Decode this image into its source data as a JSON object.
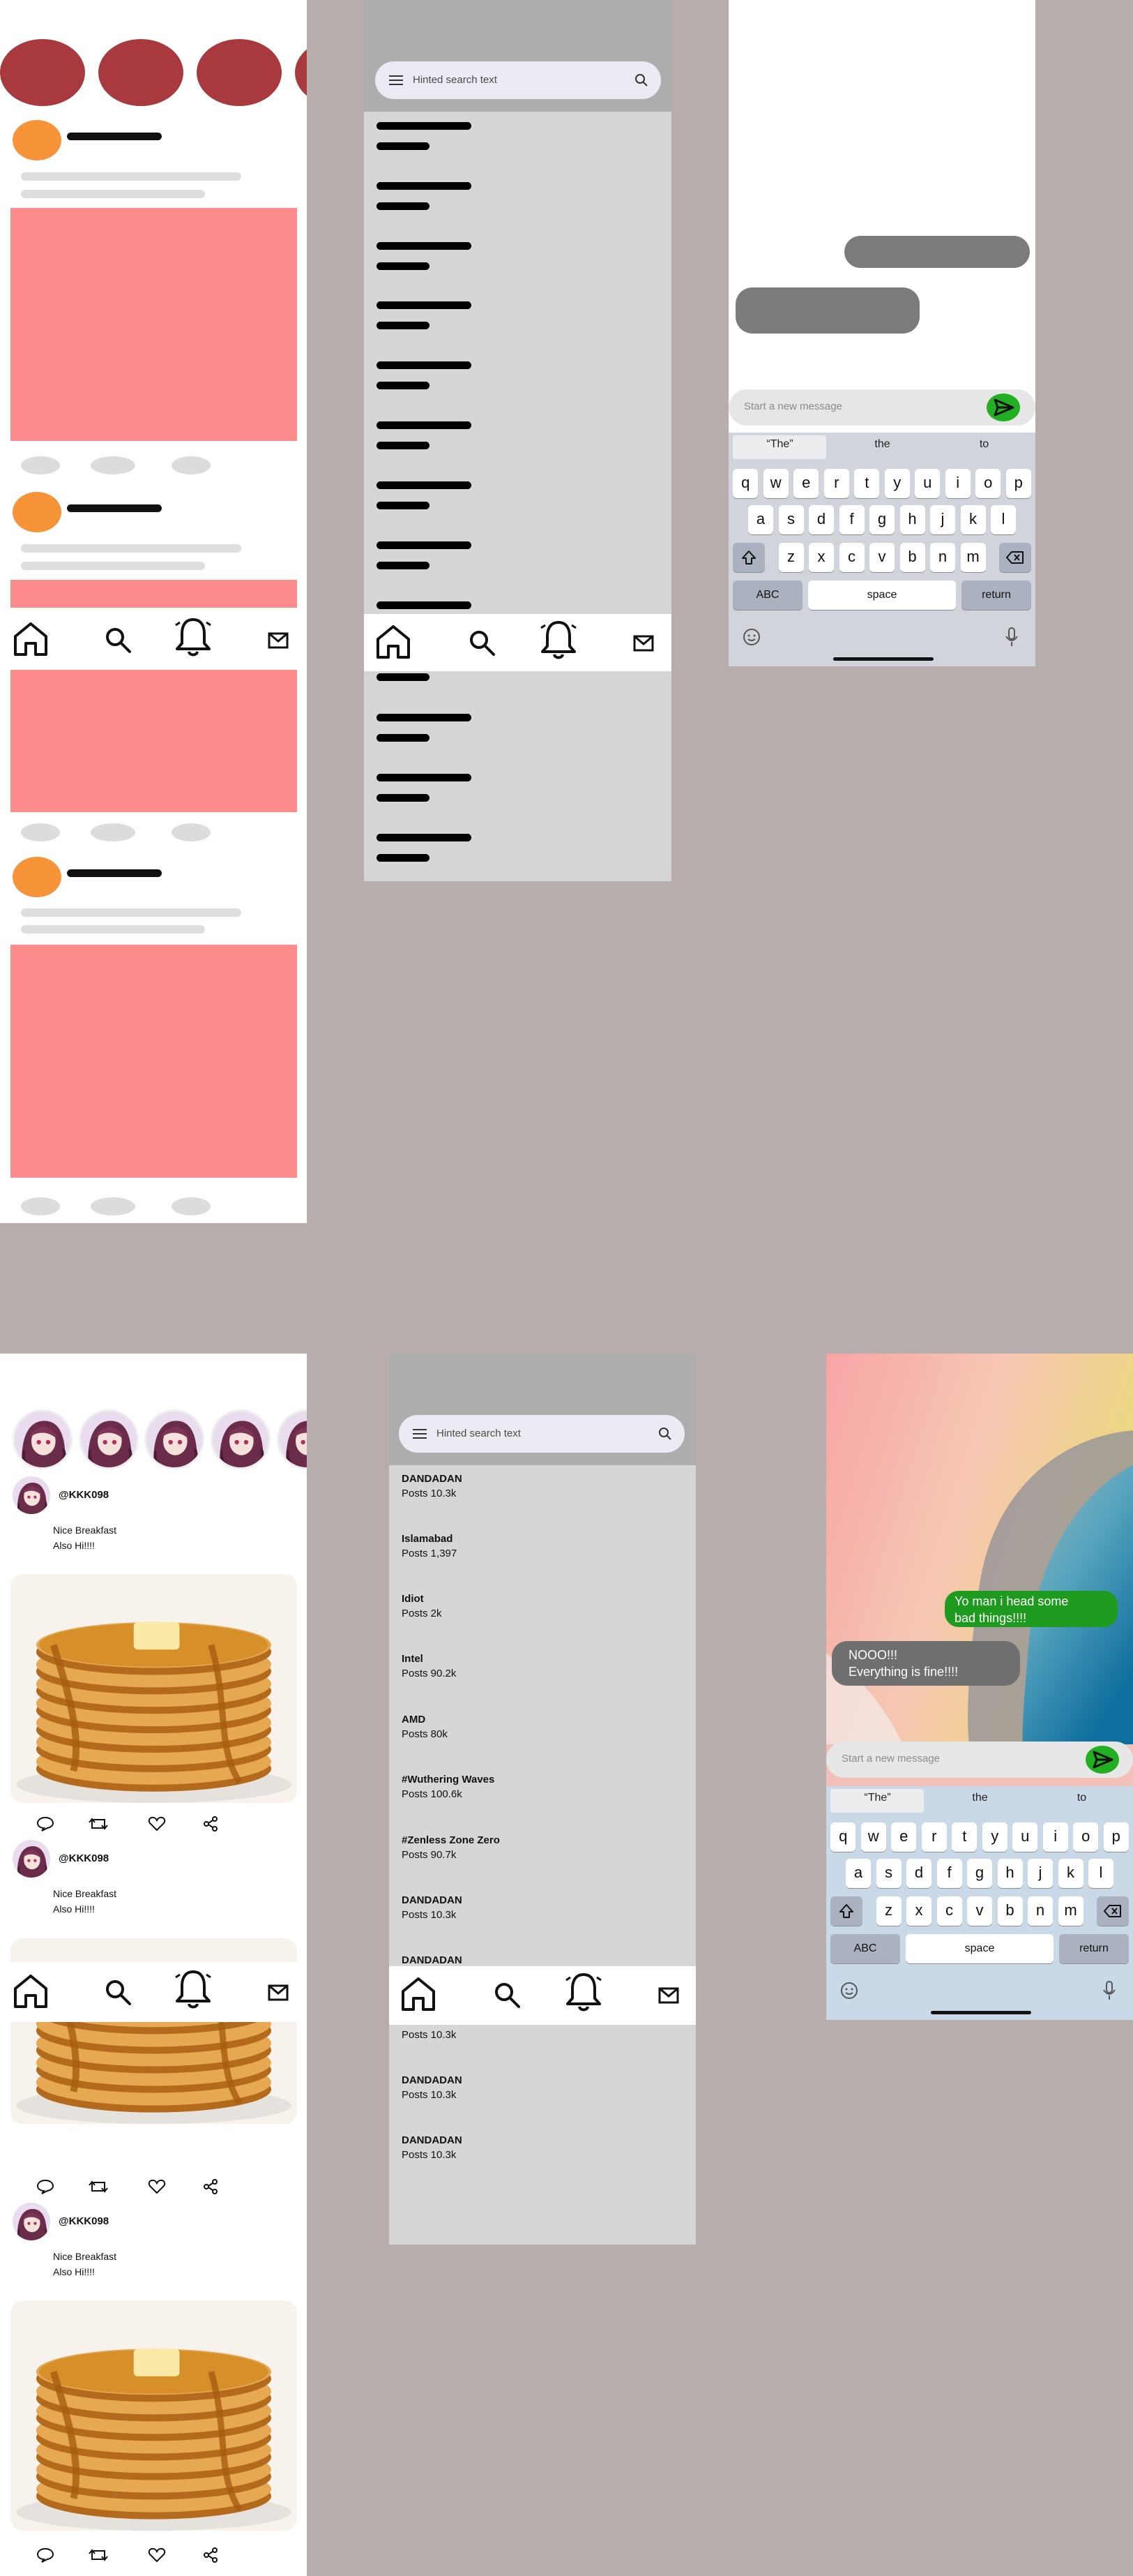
{
  "wireframe": {
    "search": {
      "placeholder": "Hinted search text"
    },
    "chat": {
      "input_placeholder": "Start a new message"
    }
  },
  "keyboard": {
    "suggestions": [
      "“The”",
      "the",
      "to"
    ],
    "row1": [
      "q",
      "w",
      "e",
      "r",
      "t",
      "y",
      "u",
      "i",
      "o",
      "p"
    ],
    "row2": [
      "a",
      "s",
      "d",
      "f",
      "g",
      "h",
      "j",
      "k",
      "l"
    ],
    "row3": [
      "z",
      "x",
      "c",
      "v",
      "b",
      "n",
      "m"
    ],
    "abc_label": "ABC",
    "space_label": "space",
    "return_label": "return"
  },
  "feed": {
    "posts": [
      {
        "handle": "@KKK098",
        "caption_line1": "Nice Breakfast",
        "caption_line2": "Also Hi!!!!"
      },
      {
        "handle": "@KKK098",
        "caption_line1": "Nice Breakfast",
        "caption_line2": "Also Hi!!!!"
      },
      {
        "handle": "@KKK098",
        "caption_line1": "Nice Breakfast",
        "caption_line2": "Also Hi!!!!"
      }
    ]
  },
  "search": {
    "placeholder": "Hinted search text",
    "topics": [
      {
        "title": "DANDADAN",
        "posts": "Posts 10.3k"
      },
      {
        "title": "Islamabad",
        "posts": "Posts 1,397"
      },
      {
        "title": "Idiot",
        "posts": "Posts 2k"
      },
      {
        "title": "Intel",
        "posts": "Posts 90.2k"
      },
      {
        "title": "AMD",
        "posts": "Posts 80k"
      },
      {
        "title": "#Wuthering Waves",
        "posts": "Posts 100.6k"
      },
      {
        "title": "#Zenless Zone Zero",
        "posts": "Posts 90.7k"
      },
      {
        "title": "DANDADAN",
        "posts": "Posts 10.3k"
      },
      {
        "title": "DANDADAN",
        "posts": "Posts 10.3k"
      },
      {
        "title": "DANDADAN",
        "posts": "Posts 10.3k"
      },
      {
        "title": "DANDADAN",
        "posts": "Posts 10.3k"
      },
      {
        "title": "DANDADAN",
        "posts": "Posts 10.3k"
      }
    ]
  },
  "chat": {
    "sent": {
      "line1": "Yo man  i head some",
      "line2": "bad things!!!!"
    },
    "received": {
      "line1": "NOOO!!!",
      "line2": "Everything is fine!!!!"
    },
    "input_placeholder": "Start a new message"
  },
  "colors": {
    "background": "#b8adad",
    "story_oval": "#a83a3f",
    "avatar_orange": "#f7943a",
    "image_pink": "#fd8b8b",
    "send_green": "#22b022",
    "sent_bubble": "#1e9a1e",
    "received_bubble": "#6f6f6f"
  }
}
